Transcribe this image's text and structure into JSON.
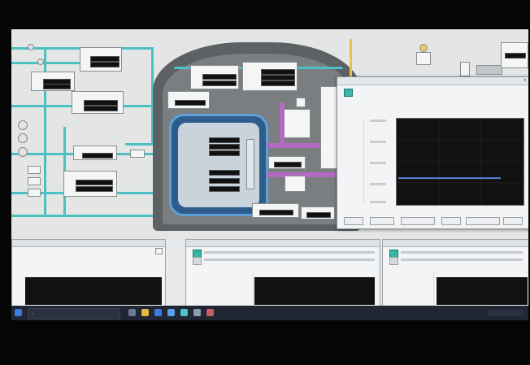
{
  "theme": {
    "accent_teal": "#4cc1c4",
    "pipe_purple": "#b36ac2",
    "vessel_blue": "#2f5d8b",
    "plot_bg": "#111111",
    "trend_line": "#5b7fd6",
    "taskbar": "#202634",
    "cursor": "#f2d21b"
  },
  "dialog": {
    "title": "",
    "rows": [
      {
        "label": "",
        "value": ""
      },
      {
        "label": "",
        "value": ""
      }
    ],
    "buttons": [
      "",
      "",
      "",
      "",
      ""
    ],
    "trend_value_fraction": 0.31
  },
  "lower_panels": [
    {
      "title": ""
    },
    {
      "title": ""
    },
    {
      "title": ""
    }
  ],
  "taskbar": {
    "search_placeholder": ""
  },
  "icons": [
    "search-icon",
    "cursor-icon",
    "close-icon",
    "window-icon",
    "app-icon"
  ]
}
